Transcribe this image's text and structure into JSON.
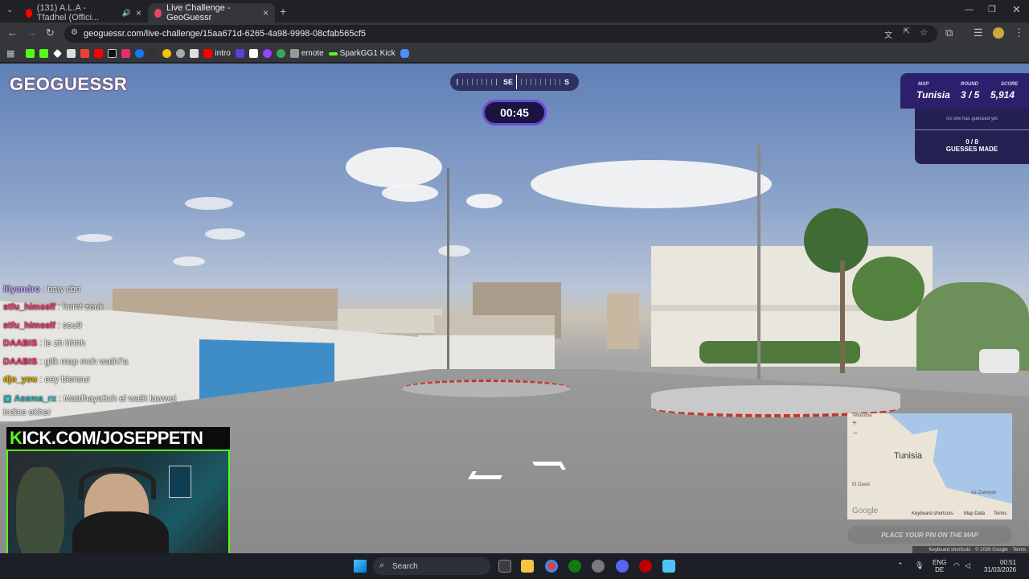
{
  "browser": {
    "tabs": [
      {
        "label": "(131) A.L.A - Tfadhel (Offici...",
        "active": false,
        "icon_color": "#ff0000"
      },
      {
        "label": "Live Challenge - GeoGuessr",
        "active": true,
        "icon_color": "#e94560"
      }
    ],
    "new_tab": "+",
    "url": "geoguessr.com/live-challenge/15aa671d-6265-4a98-9998-08cfab565cf5",
    "bookmarks": [
      {
        "label": "",
        "color": "#53fc18"
      },
      {
        "label": "",
        "color": "#53fc18"
      },
      {
        "label": "",
        "color": "#ffffff"
      },
      {
        "label": "",
        "color": "#ffffff"
      },
      {
        "label": "",
        "color": "#ea4335"
      },
      {
        "label": "",
        "color": "#ff0000"
      },
      {
        "label": "",
        "color": "#111111"
      },
      {
        "label": "",
        "color": "#e1306c"
      },
      {
        "label": "",
        "color": "#1877f2"
      },
      {
        "label": "",
        "color": "#333333"
      },
      {
        "label": "",
        "color": "#f5c400"
      },
      {
        "label": "",
        "color": "#aaaaaa"
      },
      {
        "label": "",
        "color": "#dddddd"
      },
      {
        "label": "intro",
        "color": "#ff0000"
      },
      {
        "label": "",
        "color": "#5a3fd8"
      },
      {
        "label": "",
        "color": "#ffffff"
      },
      {
        "label": "",
        "color": "#9146ff"
      },
      {
        "label": "",
        "color": "#34a853"
      },
      {
        "label": "emote",
        "color": "#999999"
      },
      {
        "label": "SparkGG1 Kick",
        "color": "#53fc18"
      },
      {
        "label": "",
        "color": "#4f8cf7"
      }
    ]
  },
  "game": {
    "logo": "GEOGUESSR",
    "compass": {
      "left_label": "SE",
      "right_label": "S"
    },
    "timer": "00:45",
    "map_label": "MAP",
    "map_value": "Tunisia",
    "round_label": "ROUND",
    "round_value": "3 / 5",
    "score_label": "SCORE",
    "score_value": "5,914",
    "guessed_status": "no one has guessed yet",
    "guesses_count": "0 / 8",
    "guesses_label": "GUESSES MADE",
    "guess_button": "PLACE YOUR PIN ON THE MAP",
    "minimap": {
      "country_label": "Tunisia",
      "city_label_1": "Teboulba",
      "city_label_2": "El Oued",
      "city_label_3": "Az-Zawiyah",
      "google": "Google",
      "shortcuts": "Keyboard shortcuts",
      "map_data": "Map Data",
      "terms": "Terms",
      "zoom_in": "+",
      "zoom_out": "−"
    },
    "footer": {
      "shortcuts": "Keyboard shortcuts",
      "copyright": "© 2026 Google",
      "terms": "Terms"
    }
  },
  "chat": [
    {
      "user": "lilyandro",
      "msg": "haw cbn",
      "color": "#c9a7ff"
    },
    {
      "user": "stfu_himself",
      "msg": "homt zouk",
      "color": "#ff3b6a"
    },
    {
      "user": "stfu_himself",
      "msg": "sou9",
      "color": "#ff3b6a"
    },
    {
      "user": "DAABIS",
      "msg": "le zh hhhh",
      "color": "#ff3b6a"
    },
    {
      "user": "DAABIS",
      "msg": "gtlk map mch wath7a",
      "color": "#ff3b6a"
    },
    {
      "user": "djo_you",
      "msg": "eey biensur",
      "color": "#e8b400"
    },
    {
      "user": "Assma_rx",
      "msg": "Matdhaya3ch el wa9t lawwej",
      "color": "#35c7c7"
    },
    {
      "user": "",
      "msg": "indice ekher",
      "color": "#ffffff"
    }
  ],
  "stream": {
    "kick_prefix": "K",
    "kick_rest": "ICK.COM/JOSEPPETN"
  },
  "taskbar": {
    "search": "Search",
    "lang_top": "ENG",
    "lang_bottom": "DE",
    "time": "00:51",
    "date": "31/03/2026",
    "icon_colors": [
      "#3d3d3d",
      "#f6c343",
      "#db4437",
      "#107c10",
      "#7a7a7a",
      "#5865f2",
      "#c00000",
      "#4fc3f7"
    ]
  }
}
